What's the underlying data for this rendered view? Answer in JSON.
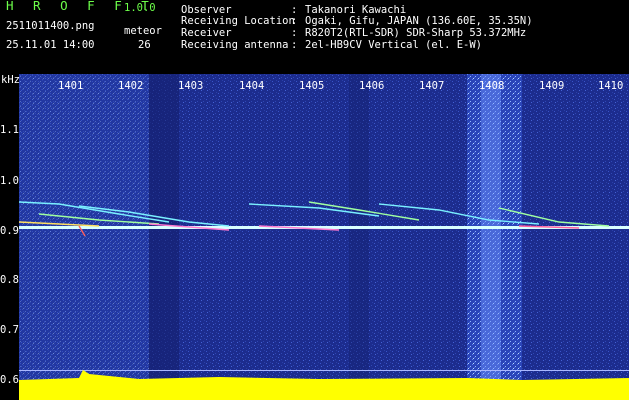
{
  "header": {
    "app_title": "H R O F F T",
    "app_version": "1.0.0",
    "file_name": "2511011400.png",
    "meteor_label": "meteor",
    "date_time": "25.11.01 14:00",
    "meteor_count": "26"
  },
  "info": {
    "colon": ":",
    "rows": [
      {
        "label": "Observer",
        "value": "Takanori Kawachi"
      },
      {
        "label": "Receiving Location",
        "value": "Ogaki, Gifu, JAPAN (136.60E, 35.35N)"
      },
      {
        "label": "Receiver",
        "value": "R820T2(RTL-SDR) SDR-Sharp 53.372MHz"
      },
      {
        "label": "Receiving antenna",
        "value": "2el-HB9CV Vertical (el. E-W)"
      }
    ]
  },
  "spectrogram": {
    "unit_label": "kHz",
    "time_labels": [
      "1401",
      "1402",
      "1403",
      "1404",
      "1405",
      "1406",
      "1407",
      "1408",
      "1409",
      "1410"
    ],
    "freq_labels": [
      "1.1",
      "1.0",
      "0.9",
      "0.8",
      "0.7",
      "0.6"
    ],
    "colors": {
      "background": "#1a2a88",
      "noise_band": "#3a5bd8",
      "signal_line": "#d8ffff",
      "baseline": "#ffff00"
    }
  }
}
